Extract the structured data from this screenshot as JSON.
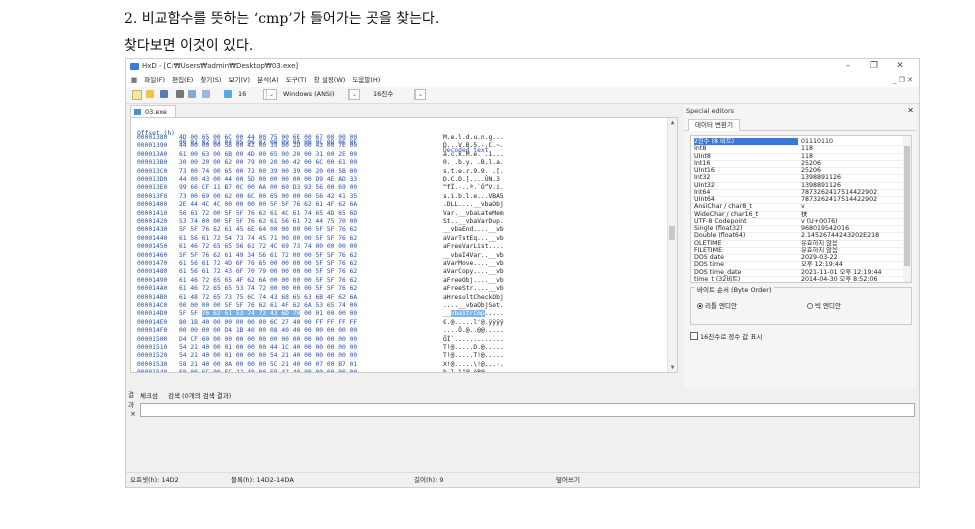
{
  "doc": {
    "line1": "2. 비교함수를 뜻하는 ‘cmp’가 들어가는 곳을 찾는다.",
    "line2": "찾다보면 이것이 있다."
  },
  "window": {
    "title": "HxD - [C:₩Users₩admin₩Desktop₩03.exe]",
    "controls": {
      "minimize": "–",
      "restore": "❐",
      "close": "✕"
    },
    "mdi_controls": "_ ❐ ✕"
  },
  "menu": [
    "파일(F)",
    "편집(E)",
    "찾기(S)",
    "보기(V)",
    "분석(A)",
    "도구(T)",
    "창 설정(W)",
    "도움말(H)"
  ],
  "toolbar": {
    "bytes_per_row": "16",
    "charset": "Windows (ANSI)",
    "offset_base": "16진수"
  },
  "tab": {
    "file": "03.exe"
  },
  "hex": {
    "header": {
      "offset": "Offset (h)",
      "hex": "00 01 02 03 04 05 06 07 08 09 0A 0B 0C 0D 0E 0F",
      "text": "Decoded text"
    },
    "rows": [
      {
        "o": "00001380",
        "h": "4D 00 65 00 6C 00 44 00 75 00 6E 00 67 00 00 00",
        "t": "M.e.l.d.u.n.g..."
      },
      {
        "o": "00001390",
        "h": "44 00 00 00 56 00 42 00 35 00 2D 00 43 00 7E 00",
        "t": "D...V.B.5.-.C.~."
      },
      {
        "o": "000013A0",
        "h": "61 00 63 00 6B 00 4D 00 65 00 20 00 31 00 2E 00",
        "t": "a.c.k.M.e. .1..."
      },
      {
        "o": "000013B0",
        "h": "30 00 20 00 62 00 79 00 20 00 42 00 6C 00 61 00",
        "t": "0. .b.y. .B.l.a."
      },
      {
        "o": "000013C0",
        "h": "73 00 74 00 65 00 72 00 39 00 39 00 20 00 5B 00",
        "t": "s.t.e.r.9.9. .[."
      },
      {
        "o": "000013D0",
        "h": "44 00 43 00 44 00 5D 00 00 00 00 00 D9 4E AD 33",
        "t": "D.C.D.]....ÙN.3"
      },
      {
        "o": "000013E0",
        "h": "99 66 CF 11 B7 0C 00 AA 00 60 D3 93 56 00 69 00",
        "t": "™fÏ.·..ª.`Ó“V.i."
      },
      {
        "o": "000013F0",
        "h": "73 00 69 00 62 00 6C 00 65 00 00 00 56 42 41 35",
        "t": "s.i.b.l.e...VBA5"
      },
      {
        "o": "00001400",
        "h": "2E 44 4C 4C 00 00 00 00 5F 5F 76 62 61 4F 62 6A",
        "t": ".DLL....__vbaObj"
      },
      {
        "o": "00001410",
        "h": "56 61 72 00 5F 5F 76 62 61 4C 61 74 65 4D 65 6D",
        "t": "Var.__vbaLateMem"
      },
      {
        "o": "00001420",
        "h": "53 74 00 00 5F 5F 76 62 61 56 61 72 44 75 70 00",
        "t": "St..__vbaVarDup."
      },
      {
        "o": "00001430",
        "h": "5F 5F 76 62 61 45 6E 64 00 00 00 00 5F 5F 76 62",
        "t": "__vbaEnd....__vb"
      },
      {
        "o": "00001440",
        "h": "61 56 61 72 54 73 74 45 71 00 00 00 5F 5F 76 62",
        "t": "aVarTstEq...__vb"
      },
      {
        "o": "00001450",
        "h": "61 46 72 65 65 56 61 72 4C 69 73 74 00 00 00 00",
        "t": "aFreeVarList...."
      },
      {
        "o": "00001460",
        "h": "5F 5F 76 62 61 49 34 56 61 72 00 00 5F 5F 76 62",
        "t": "__vbaI4Var..__vb"
      },
      {
        "o": "00001470",
        "h": "61 56 61 72 4D 6F 76 65 00 00 00 00 5F 5F 76 62",
        "t": "aVarMove....__vb"
      },
      {
        "o": "00001480",
        "h": "61 56 61 72 43 6F 70 79 00 00 00 00 5F 5F 76 62",
        "t": "aVarCopy....__vb"
      },
      {
        "o": "00001490",
        "h": "61 46 72 65 65 4F 62 6A 00 00 00 00 5F 5F 76 62",
        "t": "aFreeObj....__vb"
      },
      {
        "o": "000014A0",
        "h": "61 46 72 65 65 53 74 72 00 00 00 00 5F 5F 76 62",
        "t": "aFreeStr....__vb"
      },
      {
        "o": "000014B0",
        "h": "61 48 72 65 73 75 6C 74 43 68 65 63 6B 4F 62 6A",
        "t": "aHresultCheckObj"
      },
      {
        "o": "000014C0",
        "h": "00 00 00 00 5F 5F 76 62 61 4F 62 6A 53 65 74 00",
        "t": "....__vbaObjSet."
      },
      {
        "o": "000014D0",
        "h": "5F 5F 76 62 61 53 74 72 43 6D 70 00 01 00 00 00",
        "t": "__vbaStrCmp.....",
        "sel_hex": [
          2,
          10
        ],
        "sel_txt": [
          2,
          11
        ]
      },
      {
        "o": "000014E0",
        "h": "80 1B 40 00 00 00 00 00 6C 27 40 00 FF FF FF FF",
        "t": "€.@.....l'@.ÿÿÿÿ"
      },
      {
        "o": "000014F0",
        "h": "00 00 00 00 D4 1B 40 00 08 40 40 00 00 00 00 00",
        "t": "....Ô.@..@@....."
      },
      {
        "o": "00001500",
        "h": "D4 CF 60 00 00 00 00 00 00 00 00 00 00 00 00 00",
        "t": "ÔÏ`............."
      },
      {
        "o": "00001510",
        "h": "54 21 40 00 01 00 00 00 44 1C 40 00 00 00 00 00",
        "t": "T!@.....D.@....."
      },
      {
        "o": "00001520",
        "h": "54 21 40 00 01 00 00 00 54 21 40 00 00 00 00 00",
        "t": "T!@.....T!@....."
      },
      {
        "o": "00001530",
        "h": "58 21 40 00 0A 00 00 00 5C 21 40 00 07 00 B7 01",
        "t": "X!@.....\\!@...·."
      },
      {
        "o": "00001540",
        "h": "68 00 6C 00 EC 22 40 00 E8 42 40 00 00 00 00 00",
        "t": "h.l.ì\"@.èB@....."
      }
    ]
  },
  "special": {
    "title": "Special editors",
    "close": "✕",
    "inspector_tab": "데이터 변환기",
    "rows": [
      {
        "n": "2진수 (8 비트)",
        "v": "01110110"
      },
      {
        "n": "Int8",
        "v": "118"
      },
      {
        "n": "UInt8",
        "v": "118"
      },
      {
        "n": "Int16",
        "v": "25206"
      },
      {
        "n": "UInt16",
        "v": "25206"
      },
      {
        "n": "Int32",
        "v": "1398891126"
      },
      {
        "n": "UInt32",
        "v": "1398891126"
      },
      {
        "n": "Int64",
        "v": "7873262417514422902"
      },
      {
        "n": "UInt64",
        "v": "7873262417514422902"
      },
      {
        "n": "AnsiChar / char8_t",
        "v": "v"
      },
      {
        "n": "WideChar / char16_t",
        "v": "扶"
      },
      {
        "n": "UTF-8 Codepoint",
        "v": "v (U+0076)"
      },
      {
        "n": "Single (float32)",
        "v": "968019542016"
      },
      {
        "n": "Double (float64)",
        "v": "2.14526744243202E218"
      },
      {
        "n": "OLETIME",
        "v": "유효하지 않음"
      },
      {
        "n": "FILETIME",
        "v": "유효하지 않음"
      },
      {
        "n": "DOS date",
        "v": "2029-03-22"
      },
      {
        "n": "DOS time",
        "v": "오후 12:19:44"
      },
      {
        "n": "DOS time_date",
        "v": "2021-11-01 오후 12:19:44"
      },
      {
        "n": "time_t (32비트)",
        "v": "2014-04-30 오후 8:52:06"
      }
    ],
    "byte_order": {
      "title": "바이트 순서 (Byte Order)",
      "little": "리틀 엔디안",
      "big": "빅 엔디안"
    },
    "hex_int_check": "16진수로 정수 값 표시"
  },
  "search": {
    "side": "결과",
    "tab1": "체크섬",
    "tab2": "검색 (0개의 검색 결과)",
    "close": "×"
  },
  "status": {
    "offset": "오프셋(h): 14D2",
    "block": "블록(h): 14D2-14DA",
    "length": "길이(h): 9",
    "mode": "덮어쓰기"
  }
}
